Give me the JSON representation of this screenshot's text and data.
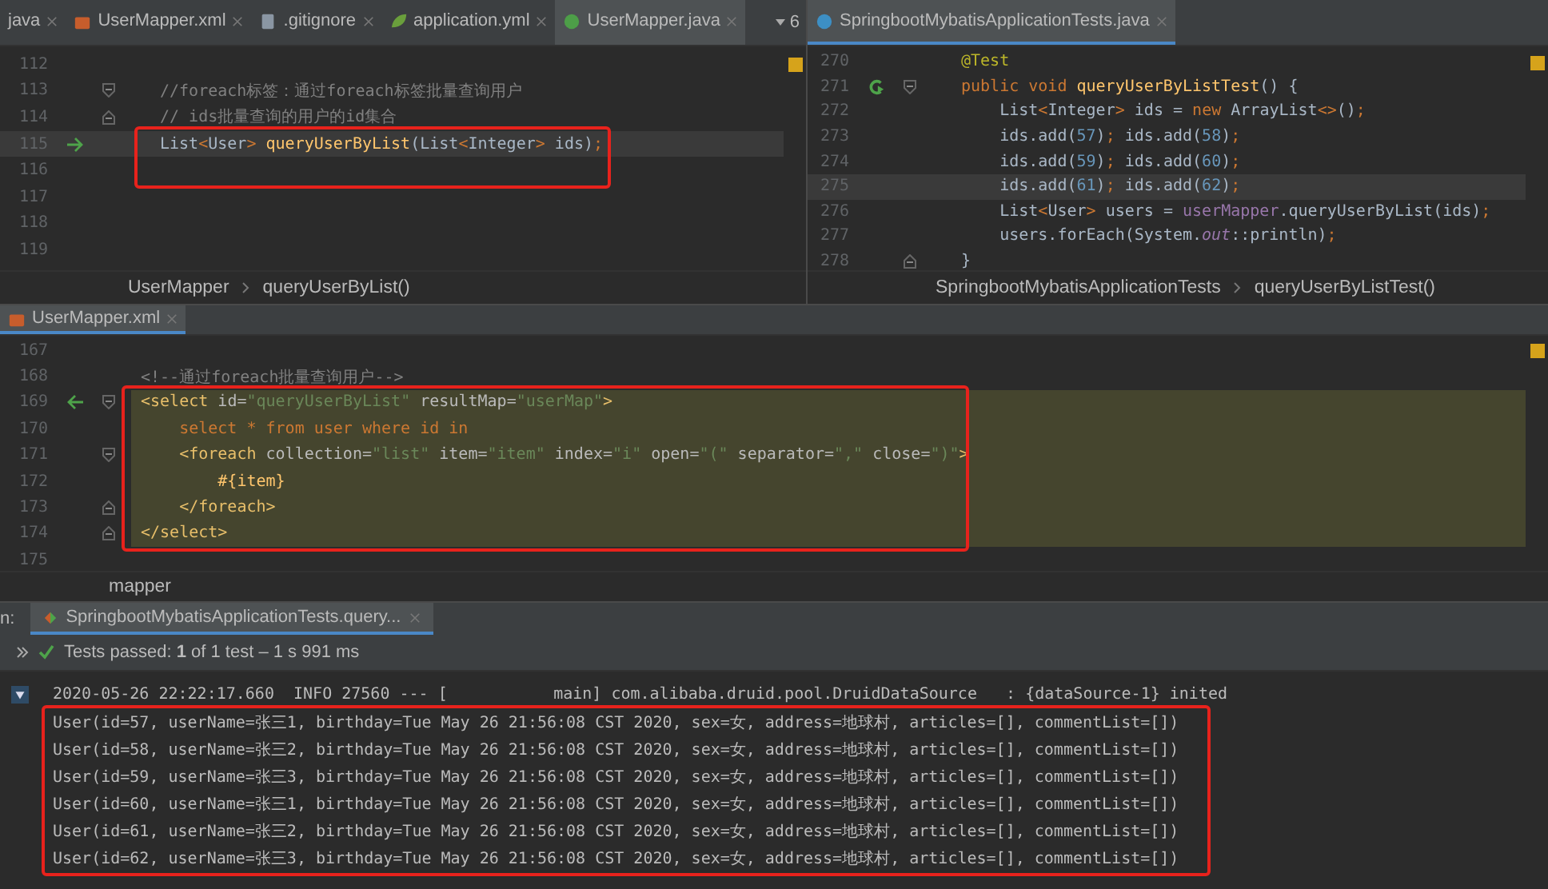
{
  "editors": [
    {
      "tabs": [
        {
          "label": "java",
          "kind": "plain",
          "selected": false
        },
        {
          "label": "UserMapper.xml",
          "kind": "xml",
          "selected": false
        },
        {
          "label": ".gitignore",
          "kind": "gitignore",
          "selected": false
        },
        {
          "label": "application.yml",
          "kind": "yml",
          "selected": false
        },
        {
          "label": "UserMapper.java",
          "kind": "interface",
          "selected": true
        }
      ],
      "overflow": "6",
      "blocks": [
        {
          "framed": false,
          "lines": [
            {
              "number": "112",
              "current": false
            },
            {
              "number": "113",
              "icons": [
                {
                  "kind": "fold-start"
                }
              ],
              "current": false,
              "tokens": [
                {
                  "kind": "cmt",
                  "text": "//foreach标签：通过foreach标签批量查询用户"
                }
              ]
            },
            {
              "number": "114",
              "icons": [
                {
                  "kind": "fold-end"
                }
              ],
              "current": false,
              "tokens": [
                {
                  "kind": "cmt",
                  "text": "// ids批量查询的用户的id集合"
                }
              ]
            }
          ]
        },
        {
          "framed": true,
          "lines": [
            {
              "number": "115",
              "icons": [
                {
                  "kind": "right-arrow"
                }
              ],
              "current": true,
              "tokens": [
                {
                  "kind": "plain",
                  "text": "List"
                },
                {
                  "kind": "kw",
                  "text": "<"
                },
                {
                  "kind": "plain",
                  "text": "User"
                },
                {
                  "kind": "kw",
                  "text": "> "
                },
                {
                  "kind": "method",
                  "text": "queryUserByList"
                },
                {
                  "kind": "plain",
                  "text": "(List"
                },
                {
                  "kind": "kw",
                  "text": "<"
                },
                {
                  "kind": "plain",
                  "text": "Integer"
                },
                {
                  "kind": "kw",
                  "text": ">"
                },
                {
                  "kind": "plain",
                  "text": " ids)"
                },
                {
                  "kind": "kw",
                  "text": ";"
                }
              ]
            },
            {
              "number": "116",
              "current": false
            }
          ]
        },
        {
          "framed": false,
          "lines": [
            {
              "number": "117",
              "current": false
            },
            {
              "number": "118",
              "current": false
            },
            {
              "number": "119",
              "current": false
            }
          ]
        }
      ],
      "breadcrumb": [
        "UserMapper",
        "queryUserByList()"
      ]
    },
    {
      "tabs": [
        {
          "label": "SpringbootMybatisApplicationTests.java",
          "kind": "test",
          "selected": true
        }
      ],
      "blocks": [
        {
          "lines": [
            {
              "number": "270",
              "current": false,
              "tokens": [
                {
                  "kind": "ann",
                  "text": "@Test"
                }
              ]
            },
            {
              "number": "271",
              "icons": [
                {
                  "kind": "run"
                },
                {
                  "kind": "fold-start"
                }
              ],
              "current": false,
              "tokens": [
                {
                  "kind": "kw",
                  "text": "public void "
                },
                {
                  "kind": "method",
                  "text": "queryUserByListTest"
                },
                {
                  "kind": "plain",
                  "text": "() {"
                }
              ]
            },
            {
              "number": "272",
              "current": false,
              "tokens": [
                {
                  "kind": "plain",
                  "text": "    List"
                },
                {
                  "kind": "kw",
                  "text": "<"
                },
                {
                  "kind": "plain",
                  "text": "Integer"
                },
                {
                  "kind": "kw",
                  "text": ">"
                },
                {
                  "kind": "plain",
                  "text": " ids = "
                },
                {
                  "kind": "kw",
                  "text": "new "
                },
                {
                  "kind": "plain",
                  "text": "ArrayList"
                },
                {
                  "kind": "kw",
                  "text": "<>"
                },
                {
                  "kind": "plain",
                  "text": "()"
                },
                {
                  "kind": "kw",
                  "text": ";"
                }
              ]
            },
            {
              "number": "273",
              "current": false,
              "tokens": [
                {
                  "kind": "plain",
                  "text": "    ids.add("
                },
                {
                  "kind": "num",
                  "text": "57"
                },
                {
                  "kind": "plain",
                  "text": ")"
                },
                {
                  "kind": "kw",
                  "text": "; "
                },
                {
                  "kind": "plain",
                  "text": "ids.add("
                },
                {
                  "kind": "num",
                  "text": "58"
                },
                {
                  "kind": "plain",
                  "text": ")"
                },
                {
                  "kind": "kw",
                  "text": ";"
                }
              ]
            },
            {
              "number": "274",
              "current": false,
              "tokens": [
                {
                  "kind": "plain",
                  "text": "    ids.add("
                },
                {
                  "kind": "num",
                  "text": "59"
                },
                {
                  "kind": "plain",
                  "text": ")"
                },
                {
                  "kind": "kw",
                  "text": "; "
                },
                {
                  "kind": "plain",
                  "text": "ids.add("
                },
                {
                  "kind": "num",
                  "text": "60"
                },
                {
                  "kind": "plain",
                  "text": ")"
                },
                {
                  "kind": "kw",
                  "text": ";"
                }
              ]
            },
            {
              "number": "275",
              "current": true,
              "tokens": [
                {
                  "kind": "plain",
                  "text": "    ids.add("
                },
                {
                  "kind": "num",
                  "text": "61"
                },
                {
                  "kind": "plain",
                  "text": ")"
                },
                {
                  "kind": "kw",
                  "text": "; "
                },
                {
                  "kind": "plain",
                  "text": "ids.add("
                },
                {
                  "kind": "num",
                  "text": "62"
                },
                {
                  "kind": "plain",
                  "text": ")"
                },
                {
                  "kind": "kw",
                  "text": ";"
                }
              ]
            },
            {
              "number": "276",
              "current": false,
              "tokens": [
                {
                  "kind": "plain",
                  "text": "    List"
                },
                {
                  "kind": "kw",
                  "text": "<"
                },
                {
                  "kind": "plain",
                  "text": "User"
                },
                {
                  "kind": "kw",
                  "text": ">"
                },
                {
                  "kind": "plain",
                  "text": " users = "
                },
                {
                  "kind": "field",
                  "text": "userMapper"
                },
                {
                  "kind": "plain",
                  "text": ".queryUserByList(ids)"
                },
                {
                  "kind": "kw",
                  "text": ";"
                }
              ]
            },
            {
              "number": "277",
              "current": false,
              "tokens": [
                {
                  "kind": "plain",
                  "text": "    users.forEach(System."
                },
                {
                  "kind": "static",
                  "text": "out"
                },
                {
                  "kind": "plain",
                  "text": "::println)"
                },
                {
                  "kind": "kw",
                  "text": ";"
                }
              ]
            },
            {
              "number": "278",
              "icons": [
                {
                  "kind": "fold-end"
                }
              ],
              "current": false,
              "tokens": [
                {
                  "kind": "plain",
                  "text": "}"
                }
              ]
            }
          ]
        }
      ],
      "breadcrumb": [
        "SpringbootMybatisApplicationTests",
        "queryUserByListTest()"
      ]
    },
    {
      "tabs": [
        {
          "label": "UserMapper.xml",
          "kind": "xml",
          "selected": true
        }
      ],
      "blocks": [
        {
          "framed": false,
          "lines": [
            {
              "number": "167",
              "highlighted": false
            },
            {
              "number": "168",
              "highlighted": false,
              "tokens": [
                {
                  "kind": "cmt",
                  "text": "<!--通过foreach批量查询用户-->"
                }
              ]
            }
          ]
        },
        {
          "framed": true,
          "lines": [
            {
              "number": "169",
              "icons": [
                {
                  "kind": "left-arrow"
                },
                {
                  "kind": "fold-start"
                }
              ],
              "highlighted": true,
              "tokens": [
                {
                  "kind": "tag",
                  "text": "<select"
                },
                {
                  "kind": "attr",
                  "text": " id="
                },
                {
                  "kind": "str",
                  "text": "\"queryUserByList\""
                },
                {
                  "kind": "attr",
                  "text": " resultMap="
                },
                {
                  "kind": "str",
                  "text": "\"userMap\""
                },
                {
                  "kind": "tag",
                  "text": ">"
                }
              ]
            },
            {
              "number": "170",
              "highlighted": true,
              "tokens": [
                {
                  "kind": "kw",
                  "text": "    select * from user where id in"
                }
              ]
            },
            {
              "number": "171",
              "icons": [
                {
                  "kind": "fold-start"
                }
              ],
              "highlighted": true,
              "tokens": [
                {
                  "kind": "tag",
                  "text": "    <foreach"
                },
                {
                  "kind": "attr",
                  "text": " collection="
                },
                {
                  "kind": "str",
                  "text": "\"list\""
                },
                {
                  "kind": "attr",
                  "text": " item="
                },
                {
                  "kind": "str",
                  "text": "\"item\""
                },
                {
                  "kind": "attr",
                  "text": " index="
                },
                {
                  "kind": "str",
                  "text": "\"i\""
                },
                {
                  "kind": "attr",
                  "text": " open="
                },
                {
                  "kind": "str",
                  "text": "\"(\""
                },
                {
                  "kind": "attr",
                  "text": " separator="
                },
                {
                  "kind": "str",
                  "text": "\",\""
                },
                {
                  "kind": "attr",
                  "text": " close="
                },
                {
                  "kind": "str",
                  "text": "\")\""
                },
                {
                  "kind": "tag",
                  "text": ">"
                }
              ]
            },
            {
              "number": "172",
              "highlighted": true,
              "tokens": [
                {
                  "kind": "method",
                  "text": "        #{item}"
                }
              ]
            },
            {
              "number": "173",
              "icons": [
                {
                  "kind": "fold-end"
                }
              ],
              "highlighted": true,
              "tokens": [
                {
                  "kind": "tag",
                  "text": "    </foreach>"
                }
              ]
            },
            {
              "number": "174",
              "icons": [
                {
                  "kind": "fold-end"
                }
              ],
              "highlighted": true,
              "tokens": [
                {
                  "kind": "tag",
                  "text": "</select>"
                }
              ]
            }
          ]
        },
        {
          "framed": false,
          "lines": [
            {
              "number": "175",
              "highlighted": false
            }
          ]
        }
      ],
      "breadcrumb": [
        "mapper"
      ]
    }
  ],
  "run": {
    "label": "n:",
    "tab": "SpringbootMybatisApplicationTests.query...",
    "status": "Tests passed: **1** of 1 test – 1 s 991 ms",
    "console": {
      "expanded": true,
      "header": "2020-05-26 22:22:17.660  INFO 27560 --- [           main] com.alibaba.druid.pool.DruidDataSource   : {dataSource-1} inited",
      "framed": true,
      "lines": [
        "User(id=57, userName=张三1, birthday=Tue May 26 21:56:08 CST 2020, sex=女, address=地球村, articles=[], commentList=[])",
        "User(id=58, userName=张三2, birthday=Tue May 26 21:56:08 CST 2020, sex=女, address=地球村, articles=[], commentList=[])",
        "User(id=59, userName=张三3, birthday=Tue May 26 21:56:08 CST 2020, sex=女, address=地球村, articles=[], commentList=[])",
        "User(id=60, userName=张三1, birthday=Tue May 26 21:56:08 CST 2020, sex=女, address=地球村, articles=[], commentList=[])",
        "User(id=61, userName=张三2, birthday=Tue May 26 21:56:08 CST 2020, sex=女, address=地球村, articles=[], commentList=[])",
        "User(id=62, userName=张三3, birthday=Tue May 26 21:56:08 CST 2020, sex=女, address=地球村, articles=[], commentList=[])"
      ]
    }
  }
}
